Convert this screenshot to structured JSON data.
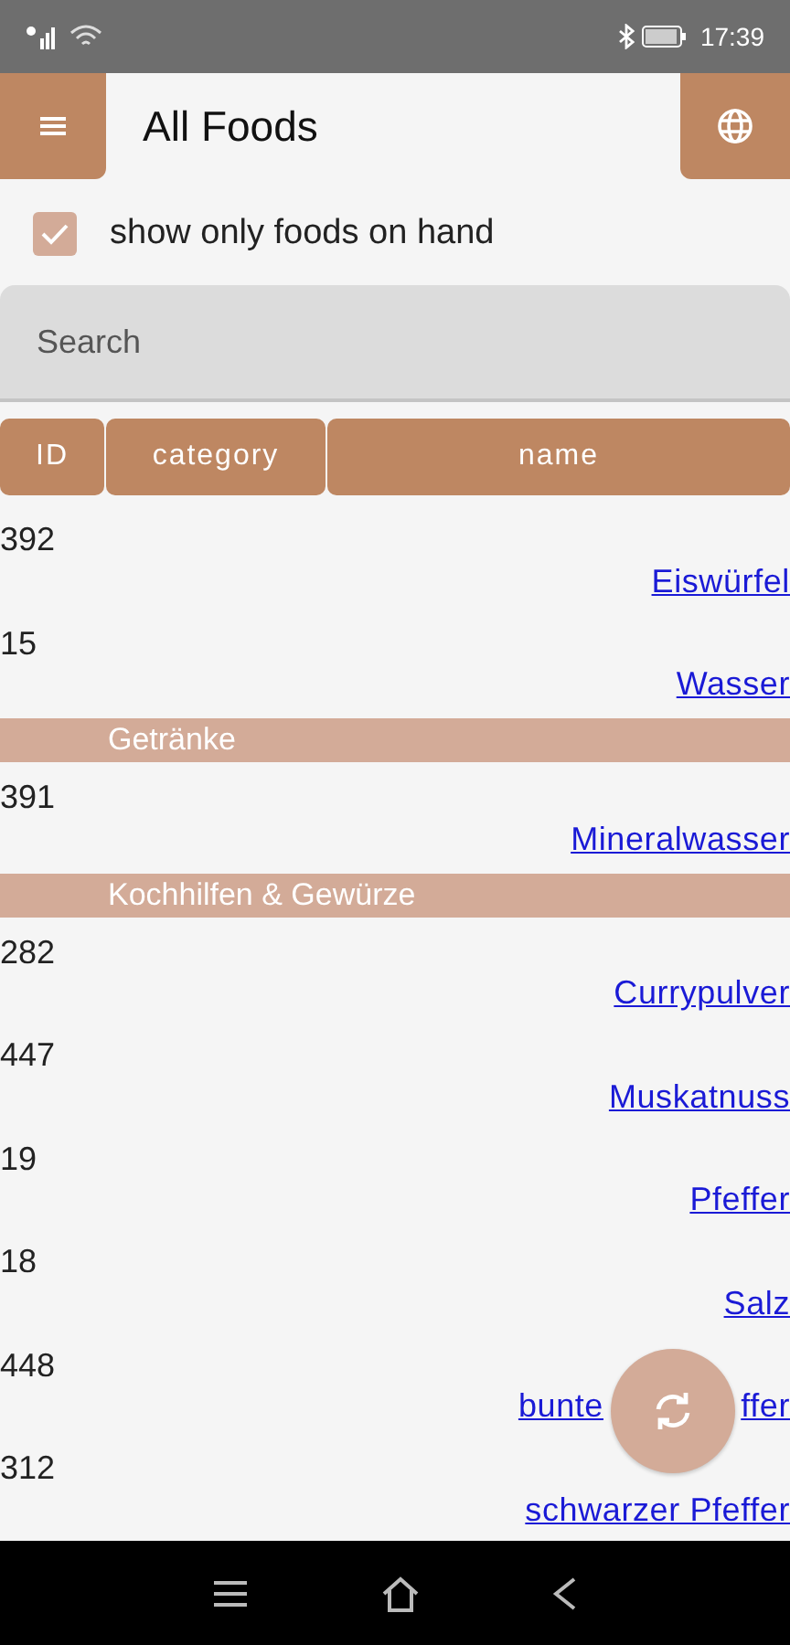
{
  "status_bar": {
    "time": "17:39"
  },
  "app_bar": {
    "title": "All Foods"
  },
  "filter": {
    "label": "show only foods on hand",
    "checked": true
  },
  "search": {
    "placeholder": "Search"
  },
  "table": {
    "columns": [
      "ID",
      "category",
      "name"
    ],
    "rows": [
      {
        "kind": "food",
        "id": "392",
        "name": "Eiswürfel"
      },
      {
        "kind": "food",
        "id": "15",
        "name": "Wasser"
      },
      {
        "kind": "group",
        "category": "Getränke"
      },
      {
        "kind": "food",
        "id": "391",
        "name": "Mineralwasser"
      },
      {
        "kind": "group",
        "category": "Kochhilfen & Gewürze"
      },
      {
        "kind": "food",
        "id": "282",
        "name": "Currypulver"
      },
      {
        "kind": "food",
        "id": "447",
        "name": "Muskatnuss"
      },
      {
        "kind": "food",
        "id": "19",
        "name": "Pfeffer"
      },
      {
        "kind": "food",
        "id": "18",
        "name": "Salz"
      },
      {
        "kind": "food",
        "id": "448",
        "name_parts": [
          "bunte",
          "ffer"
        ]
      },
      {
        "kind": "food",
        "id": "312",
        "name": "schwarzer Pfeffer"
      }
    ]
  }
}
